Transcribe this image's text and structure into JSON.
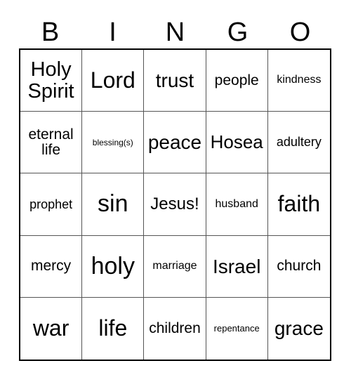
{
  "card": {
    "title_letters": [
      "B",
      "I",
      "N",
      "G",
      "O"
    ],
    "grid": {
      "rows": 5,
      "columns": 5,
      "border_color": "#000000",
      "line_color": "#555555",
      "background": "#ffffff",
      "text_color": "#000000"
    },
    "cells": [
      {
        "text": "Holy Spirit",
        "size": "s-5xl"
      },
      {
        "text": "Lord",
        "size": "s-6xl"
      },
      {
        "text": "trust",
        "size": "s-4xl"
      },
      {
        "text": "people",
        "size": "s-xl"
      },
      {
        "text": "kindness",
        "size": "s-md"
      },
      {
        "text": "eternal life",
        "size": "s-xl"
      },
      {
        "text": "blessing(s)",
        "size": "s-xs"
      },
      {
        "text": "peace",
        "size": "s-4xl"
      },
      {
        "text": "Hosea",
        "size": "s-3xl"
      },
      {
        "text": "adultery",
        "size": "s-lg"
      },
      {
        "text": "prophet",
        "size": "s-lg"
      },
      {
        "text": "sin",
        "size": "s-7xl"
      },
      {
        "text": "Jesus!",
        "size": "s-2xl"
      },
      {
        "text": "husband",
        "size": "s-md"
      },
      {
        "text": "faith",
        "size": "s-6xl"
      },
      {
        "text": "mercy",
        "size": "s-xl"
      },
      {
        "text": "holy",
        "size": "s-7xl"
      },
      {
        "text": "marriage",
        "size": "s-md"
      },
      {
        "text": "Israel",
        "size": "s-4xl"
      },
      {
        "text": "church",
        "size": "s-xl"
      },
      {
        "text": "war",
        "size": "s-6xl"
      },
      {
        "text": "life",
        "size": "s-6xl"
      },
      {
        "text": "children",
        "size": "s-xl"
      },
      {
        "text": "repentance",
        "size": "s-sm"
      },
      {
        "text": "grace",
        "size": "s-4xl"
      }
    ]
  }
}
